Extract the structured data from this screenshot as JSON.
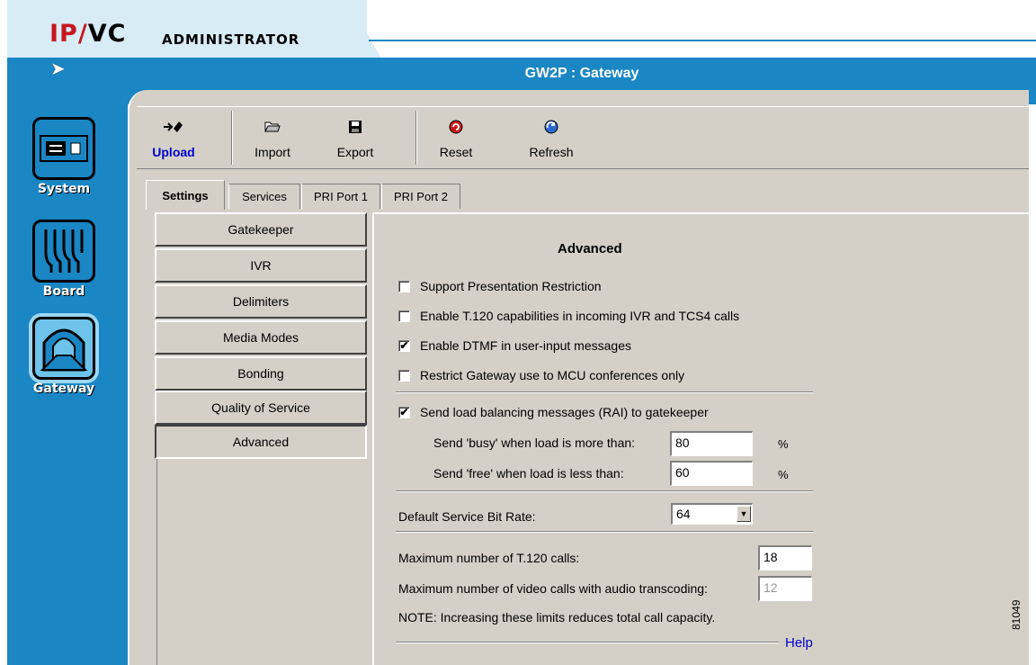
{
  "brand": {
    "logo_ip": "IP",
    "logo_slash": "/",
    "logo_vc": "VC",
    "subtitle": "ADMINISTRATOR"
  },
  "window": {
    "title": "GW2P : Gateway"
  },
  "nav": [
    {
      "label": "System",
      "icon": "system-icon"
    },
    {
      "label": "Board",
      "icon": "board-icon"
    },
    {
      "label": "Gateway",
      "icon": "gateway-icon",
      "selected": true
    }
  ],
  "toolbar": [
    {
      "label": "Upload",
      "icon": "upload-icon"
    },
    {
      "label": "Import",
      "icon": "folder-open-icon"
    },
    {
      "label": "Export",
      "icon": "floppy-disk-icon"
    },
    {
      "label": "Reset",
      "icon": "reset-icon"
    },
    {
      "label": "Refresh",
      "icon": "refresh-icon"
    }
  ],
  "tabs": [
    {
      "label": "Settings",
      "active": true
    },
    {
      "label": "Services"
    },
    {
      "label": "PRI Port 1"
    },
    {
      "label": "PRI Port 2"
    }
  ],
  "side_menu": [
    {
      "label": "Gatekeeper"
    },
    {
      "label": "IVR"
    },
    {
      "label": "Delimiters"
    },
    {
      "label": "Media Modes"
    },
    {
      "label": "Bonding"
    },
    {
      "label": "Quality of Service"
    },
    {
      "label": "Advanced",
      "active": true
    }
  ],
  "advanced": {
    "title": "Advanced",
    "options": [
      {
        "label": "Support Presentation Restriction",
        "checked": false
      },
      {
        "label": "Enable T.120 capabilities in incoming IVR and TCS4 calls",
        "checked": false
      },
      {
        "label": "Enable DTMF in user-input messages",
        "checked": true
      },
      {
        "label": "Restrict Gateway use to MCU conferences only",
        "checked": false
      }
    ],
    "load_balancing": {
      "label": "Send load balancing messages (RAI) to gatekeeper",
      "checked": true,
      "busy_label": "Send 'busy' when load is more than:",
      "busy_value": "80",
      "free_label": "Send 'free' when load is less than:",
      "free_value": "60",
      "unit": "%"
    },
    "bit_rate": {
      "label": "Default Service Bit Rate:",
      "value": "64"
    },
    "limits": {
      "t120_label": "Maximum number of T.120 calls:",
      "t120_value": "18",
      "transcoding_label": "Maximum number of video calls with audio transcoding:",
      "transcoding_value": "12",
      "note": "NOTE: Increasing these limits reduces total call capacity."
    },
    "help_label": "Help"
  },
  "figure_number": "81049",
  "check_mark": "✔"
}
